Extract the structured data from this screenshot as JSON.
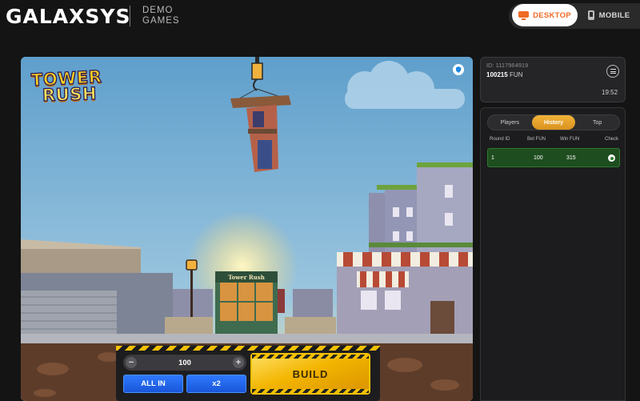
{
  "brand": {
    "logo": "GALAXSYS",
    "demo_label": "DEMO GAMES"
  },
  "view_toggle": {
    "desktop": "DESKTOP",
    "mobile": "MOBILE",
    "active": "desktop",
    "accent": "#ef6a25"
  },
  "game": {
    "title_line1": "TOWER",
    "title_line2": "RUSH",
    "shop_sign": "Tower Rush",
    "bet_value": "100",
    "minus_label": "−",
    "plus_label": "+",
    "all_in_label": "ALL IN",
    "x2_label": "x2",
    "build_label": "BUILD",
    "icons": [
      "shield-icon",
      "minus-icon",
      "plus-icon"
    ]
  },
  "session": {
    "id_text": "ID: 1117964919",
    "balance": "100215",
    "currency": "FUN",
    "time": "19:52",
    "menu_icon": "menu-icon"
  },
  "history_panel": {
    "tabs": [
      {
        "label": "Players",
        "active": false
      },
      {
        "label": "History",
        "active": true
      },
      {
        "label": "Top",
        "active": false
      }
    ],
    "columns": {
      "round": "Round ID",
      "bet": "Bet FUN",
      "win": "Win FUN",
      "check": "Check"
    },
    "rows": [
      {
        "round": "1",
        "bet": "100",
        "win": "315",
        "status_color": "#2d7a2f"
      }
    ]
  }
}
